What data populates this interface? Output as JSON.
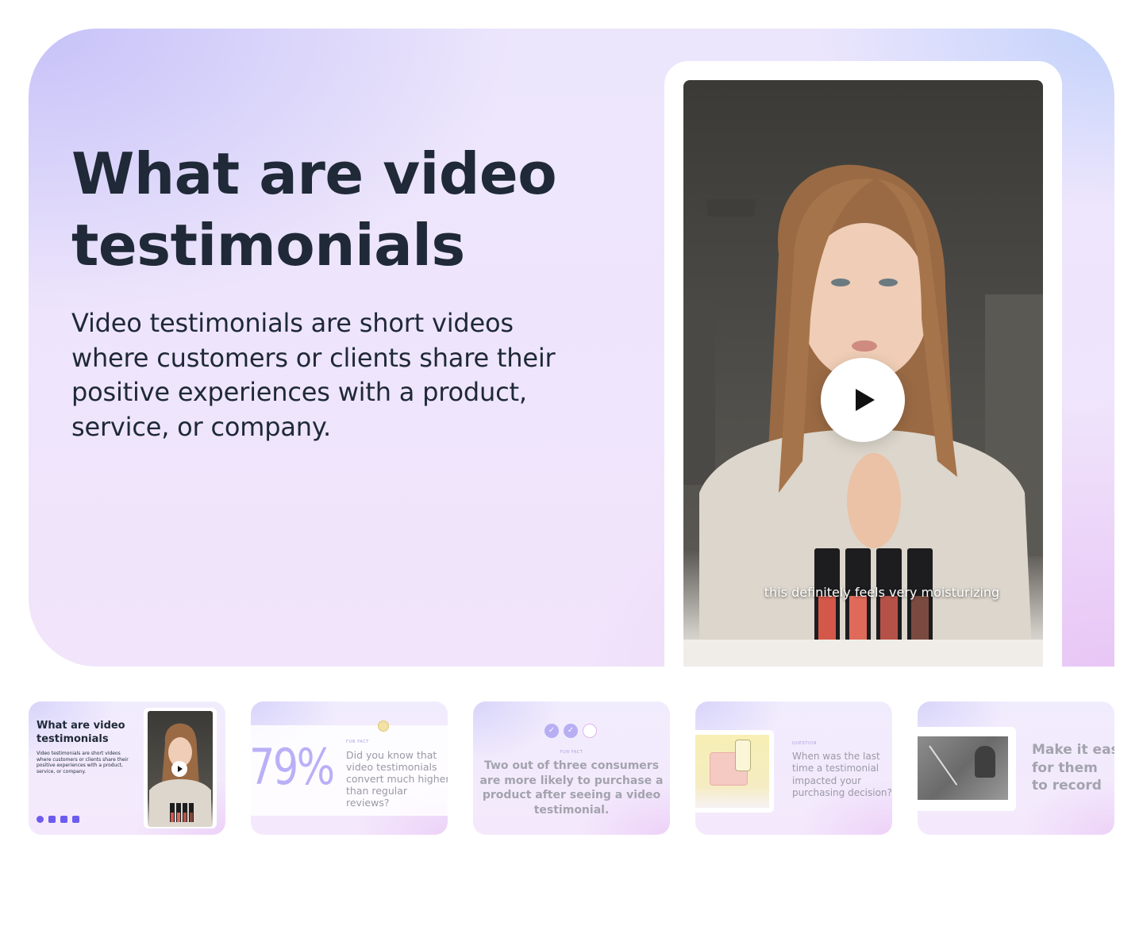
{
  "hero": {
    "title": "What are video testimonials",
    "description": "Video testimonials are short videos where customers or clients share their positive experiences with a product, service, or company.",
    "video_caption": "this definitely feels very moisturizing",
    "play_icon": "play-icon"
  },
  "thumbnails": [
    {
      "title": "What are video testimonials",
      "description": "Video testimonials are short videos where customers or clients share their positive experiences with a product, service, or company.",
      "social_icons": [
        "facebook-icon",
        "instagram-icon",
        "tiktok-icon",
        "youtube-icon"
      ]
    },
    {
      "stat": "79%",
      "label": "FUN FACT",
      "text": "Did you know that video testimonials convert much higher than regular reviews?"
    },
    {
      "label": "FUN FACT",
      "checks": [
        "✓",
        "✓",
        ""
      ],
      "text": "Two out of three consumers are more likely to purchase a product after seeing a video testimonial."
    },
    {
      "label": "QUESTION",
      "text": "When was the last time a testimonial impacted your purchasing decision?"
    },
    {
      "text_lines": [
        "Make it easy",
        "for them",
        "to record"
      ]
    }
  ],
  "colors": {
    "accent": "#6d5bf0",
    "stat": "#b9b0f7",
    "title": "#1f2937",
    "muted": "#a3a3ad"
  }
}
